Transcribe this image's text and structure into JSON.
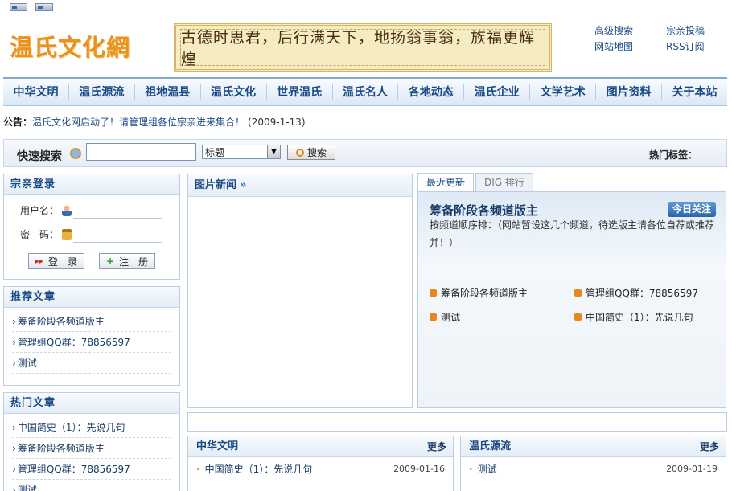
{
  "header": {
    "logo_text": "温氏文化網",
    "banner_text": "古德时思君，后行满天下，地扬翁事翁，族福更辉煌",
    "links": [
      "高级搜索",
      "宗亲投稿",
      "网站地图",
      "RSS订阅"
    ]
  },
  "nav": [
    "中华文明",
    "温氏源流",
    "祖地温县",
    "温氏文化",
    "世界温氏",
    "温氏名人",
    "各地动态",
    "温氏企业",
    "文学艺术",
    "图片资料",
    "关于本站"
  ],
  "notice": {
    "label": "公告：",
    "text": "温氏文化网启动了！请管理组各位宗亲进来集合！",
    "date": "(2009-1-13)"
  },
  "search": {
    "label": "快速搜索",
    "input_value": "",
    "select_value": "标题",
    "button_label": "搜索",
    "hot_tags_label": "热门标签："
  },
  "login": {
    "title": "宗亲登录",
    "username_label": "用户名：",
    "password_label": "密　码：",
    "login_button": "登　录",
    "register_button": "注　册"
  },
  "recommended": {
    "title": "推荐文章",
    "items": [
      "筹备阶段各频道版主",
      "管理组QQ群：78856597",
      "测试"
    ]
  },
  "hot": {
    "title": "热门文章",
    "items": [
      "中国简史（1）：先说几句",
      "筹备阶段各频道版主",
      "管理组QQ群：78856597",
      "测试"
    ]
  },
  "pic_news": {
    "title": "图片新闻",
    "chevrons": "»"
  },
  "tabs": [
    "最近更新",
    "DIG 排行"
  ],
  "featured": {
    "title": "筹备阶段各频道版主",
    "badge": "今日关注",
    "desc": "按频道顺序排：（网站暂设这几个频道，待选版主请各位自荐或推荐并！）",
    "links": [
      "筹备阶段各频道版主",
      "管理组QQ群：78856597",
      "测试",
      "中国简史（1）：先说几句"
    ]
  },
  "bottom": [
    {
      "title": "中华文明",
      "more": "更多",
      "rows": [
        {
          "text": "中国简史（1）：先说几句",
          "date": "2009-01-16"
        }
      ]
    },
    {
      "title": "温氏源流",
      "more": "更多",
      "rows": [
        {
          "text": "测试",
          "date": "2009-01-19"
        }
      ]
    }
  ]
}
